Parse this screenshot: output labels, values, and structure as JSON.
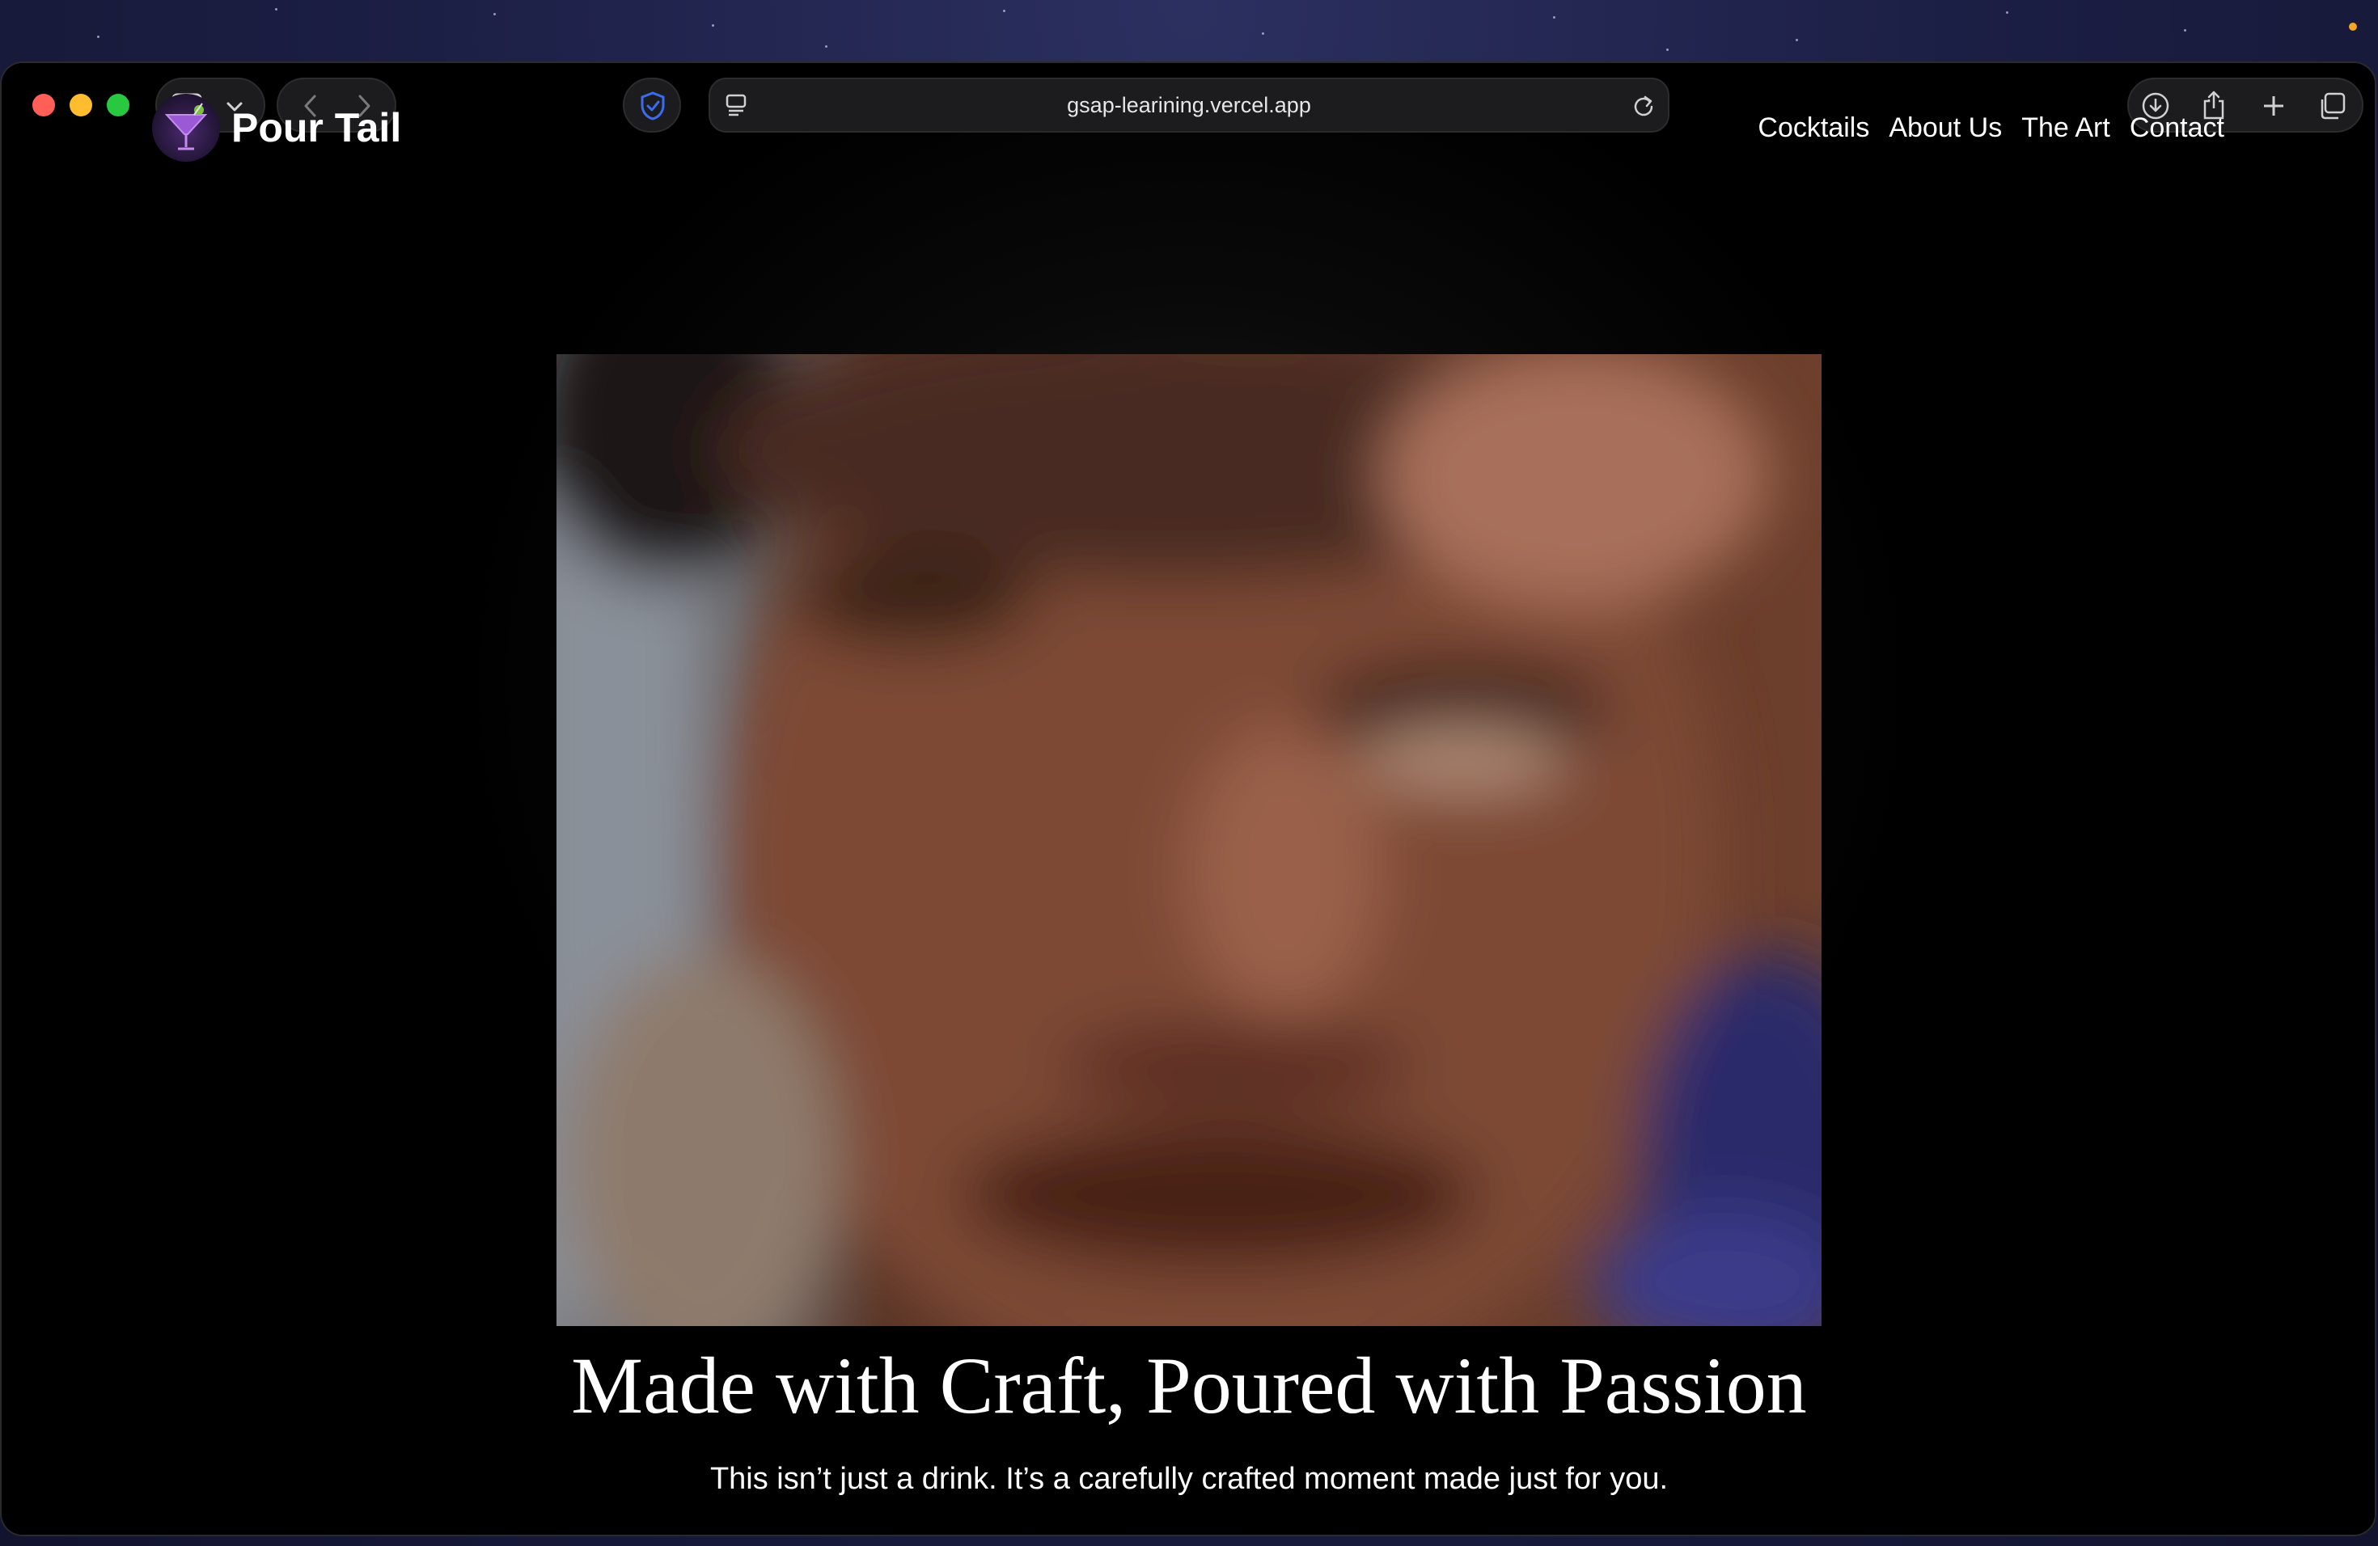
{
  "browser": {
    "url": "gsap-learining.vercel.app"
  },
  "site": {
    "brand": "Pour Tail",
    "nav": [
      {
        "label": "Cocktails"
      },
      {
        "label": "About Us"
      },
      {
        "label": "The Art"
      },
      {
        "label": "Contact"
      }
    ],
    "hero": {
      "title": "Made with Craft, Poured with Passion",
      "subtitle": "This isn’t just a drink. It’s a carefully crafted moment made just for you."
    }
  },
  "colors": {
    "accent_shield": "#3b6cf0",
    "logo_purple": "#9b59d6",
    "close": "#ff5f57",
    "minimize": "#febc2e",
    "zoom": "#28c840"
  },
  "icons": {
    "sidebar": "sidebar-icon",
    "chevron": "chevron-down-icon",
    "back": "chevron-left-icon",
    "forward": "chevron-right-icon",
    "shield": "shield-icon",
    "reader": "reader-icon",
    "reload": "reload-icon",
    "download": "download-icon",
    "share": "share-icon",
    "new_tab": "plus-icon",
    "tabs": "tabs-overview-icon"
  }
}
